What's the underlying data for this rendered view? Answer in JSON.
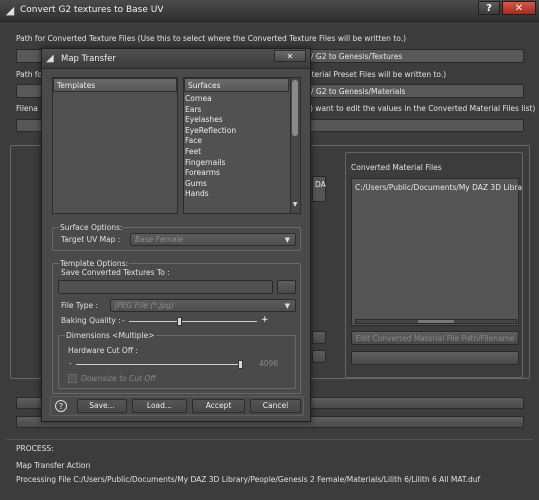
{
  "window": {
    "title": "Convert G2 textures to Base UV",
    "help_label": "?",
    "close_label": "✕"
  },
  "main": {
    "texture_path_label": "Path for Converted Texture Files (Use this to select where the Converted Texture Files will be written to.)",
    "texture_path_value": "/ G2 to Genesis/Textures",
    "material_path_label_start": "Path fo",
    "material_path_label_end": "aterial Preset Files will be written to.)",
    "material_path_value": "/ G2 to Genesis/Materials",
    "filename_label_start": "Filena",
    "filename_label_end": ") want to edit the values in the Converted Material Files list)",
    "partial_text": "DA",
    "converted_header": "Converted Material Files",
    "converted_items": [
      "C:/Users/Public/Documents/My DAZ 3D Libra"
    ],
    "edit_path_button": "Edit Converted Material File Path/Filename",
    "process_label": "PROCESS:",
    "process_action": "Map Transfer Action",
    "process_file": "Processing File C:/Users/Public/Documents/My DAZ 3D Library/People/Genesis 2 Female/Materials/Lilith 6/Lilith 6 All MAT.duf"
  },
  "dialog": {
    "title": "Map Transfer",
    "close_label": "✕",
    "templates_header": "Templates",
    "surfaces_header": "Surfaces",
    "surfaces": [
      "Cornea",
      "Ears",
      "Eyelashes",
      "EyeReflection",
      "Face",
      "Feet",
      "Fingernails",
      "Forearms",
      "Gums",
      "Hands"
    ],
    "surface_options_label": "Surface Options:",
    "target_uv_label": "Target UV Map :",
    "target_uv_value": "Base Female",
    "template_options_label": "Template Options:",
    "save_textures_label": "Save Converted Textures To :",
    "file_type_label": "File Type :",
    "file_type_value": "JPEG File (*.jpg)",
    "baking_quality_label": "Baking Quality :",
    "baking_quality_minus": "-",
    "baking_quality_plus": "+",
    "baking_quality_fraction": 0.4,
    "dimensions_label": "Dimensions <Multiple>",
    "hardware_cutoff_label": "Hardware Cut Off :",
    "hardware_cutoff_value": "4096",
    "hardware_cutoff_fraction": 1.0,
    "downsize_label": "Downsize to Cut Off",
    "help_icon": "?",
    "save_button": "Save...",
    "load_button": "Load...",
    "accept_button": "Accept",
    "cancel_button": "Cancel"
  }
}
